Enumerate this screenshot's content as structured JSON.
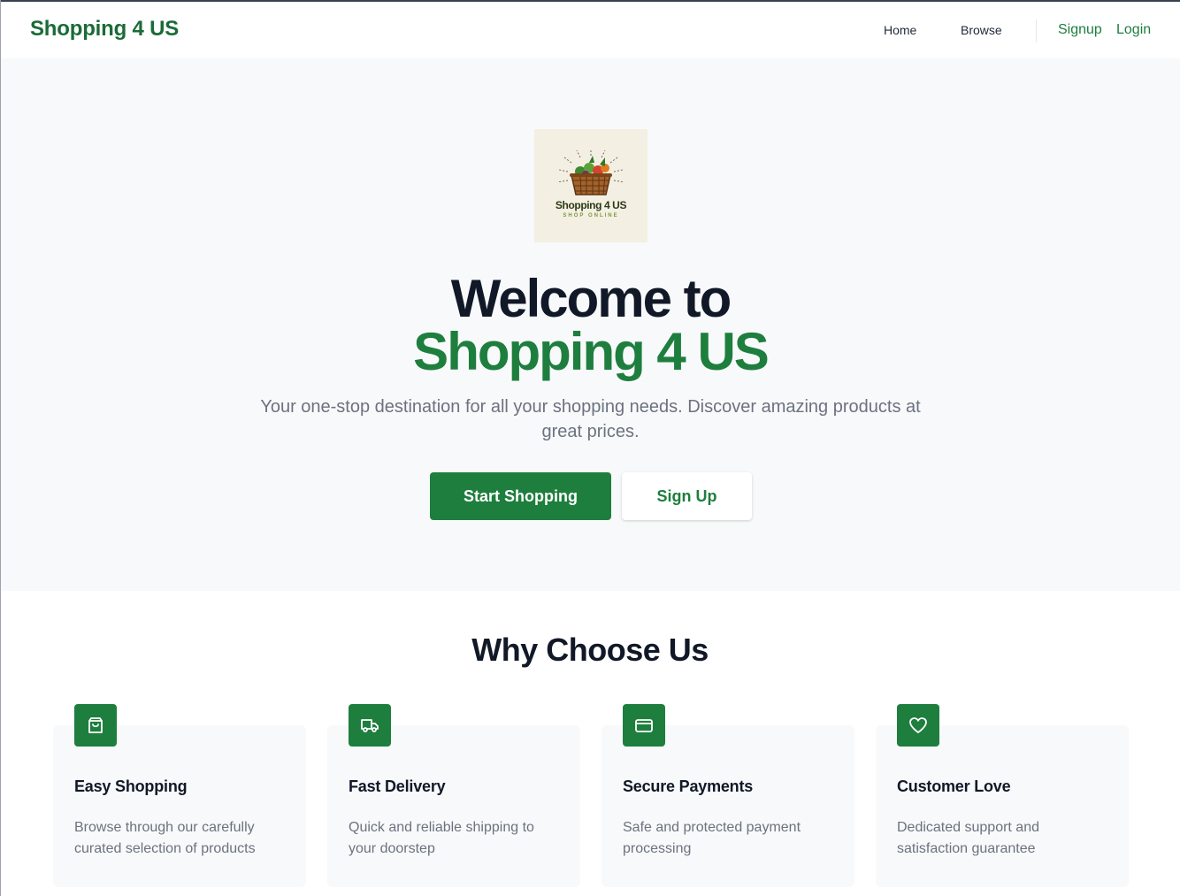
{
  "colors": {
    "brand": "#1b6b37",
    "accent": "#1e7e3e",
    "hero_bg": "#f8f9fa",
    "heading": "#111827",
    "muted": "#6b7280"
  },
  "header": {
    "brand": "Shopping 4 US",
    "nav": {
      "home": "Home",
      "browse": "Browse"
    },
    "auth": {
      "signup": "Signup",
      "login": "Login"
    }
  },
  "hero": {
    "logo": {
      "title": "Shopping 4 US",
      "subtitle": "SHOP ONLINE",
      "icon": "basket-of-produce-icon"
    },
    "title_line1": "Welcome to",
    "title_line2": "Shopping 4 US",
    "description": "Your one-stop destination for all your shopping needs. Discover amazing products at great prices.",
    "primary_button": "Start Shopping",
    "secondary_button": "Sign Up"
  },
  "features": {
    "title": "Why Choose Us",
    "items": [
      {
        "icon": "shopping-bag-icon",
        "title": "Easy Shopping",
        "text": "Browse through our carefully curated selection of products"
      },
      {
        "icon": "truck-icon",
        "title": "Fast Delivery",
        "text": "Quick and reliable shipping to your doorstep"
      },
      {
        "icon": "credit-card-icon",
        "title": "Secure Payments",
        "text": "Safe and protected payment processing"
      },
      {
        "icon": "heart-icon",
        "title": "Customer Love",
        "text": "Dedicated support and satisfaction guarantee"
      }
    ]
  }
}
